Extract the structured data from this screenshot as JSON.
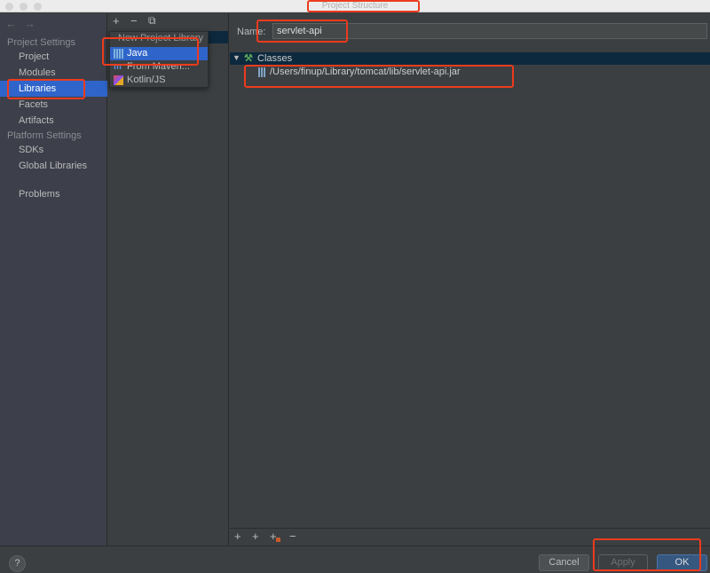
{
  "window": {
    "title": "Project Structure"
  },
  "nav": {
    "back": "←",
    "forward": "→"
  },
  "sidebar": {
    "project_settings": "Project Settings",
    "items": [
      {
        "label": "Project"
      },
      {
        "label": "Modules"
      },
      {
        "label": "Libraries"
      },
      {
        "label": "Facets"
      },
      {
        "label": "Artifacts"
      }
    ],
    "platform_settings": "Platform Settings",
    "platform_items": [
      {
        "label": "SDKs"
      },
      {
        "label": "Global Libraries"
      }
    ],
    "problems": "Problems"
  },
  "toolbar": {
    "add": "+",
    "remove": "−",
    "copy": "⧉"
  },
  "popup": {
    "title": "New Project Library",
    "items": [
      {
        "label": "Java"
      },
      {
        "label": "From Maven..."
      },
      {
        "label": "Kotlin/JS"
      }
    ]
  },
  "library": {
    "name_label": "Name:",
    "name_value": "servlet-api",
    "classes_label": "Classes",
    "jar_path": "/Users/finup/Library/tomcat/lib/servlet-api.jar"
  },
  "bottom_toolbar": {
    "add": "+",
    "add_alt": "+",
    "add_dir": "+",
    "remove": "−"
  },
  "footer": {
    "help": "?",
    "cancel": "Cancel",
    "apply": "Apply",
    "ok": "OK"
  },
  "colors": {
    "selection": "#2f65ca",
    "annotation": "#ec3b1d"
  }
}
